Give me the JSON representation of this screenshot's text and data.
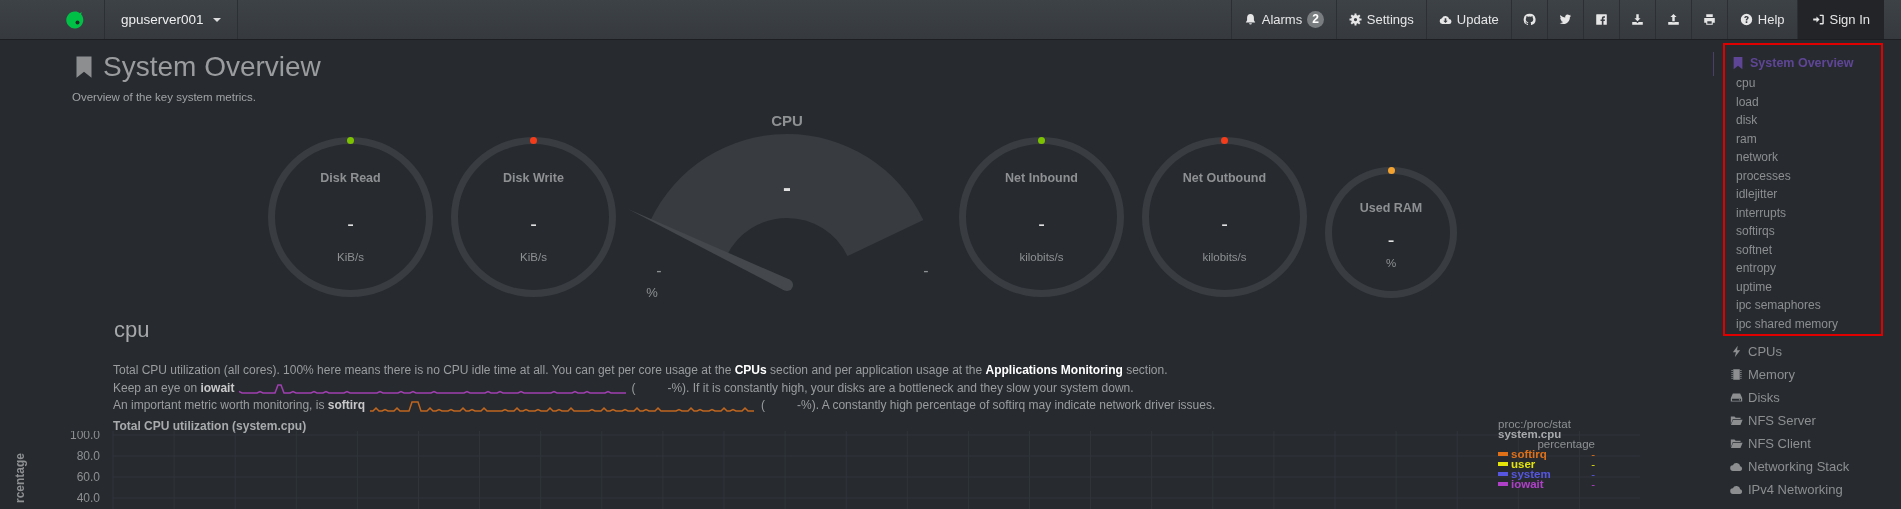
{
  "navbar": {
    "server": "gpuserver001",
    "buttons": [
      {
        "kind": "labeled",
        "label": "Alarms",
        "badge": "2"
      },
      {
        "kind": "labeled",
        "label": "Settings"
      },
      {
        "kind": "labeled",
        "label": "Update"
      },
      {
        "kind": "icon"
      },
      {
        "kind": "icon"
      },
      {
        "kind": "icon"
      },
      {
        "kind": "icon"
      },
      {
        "kind": "icon"
      },
      {
        "kind": "icon"
      },
      {
        "kind": "labeled",
        "label": "Help"
      },
      {
        "kind": "account",
        "label": "Sign In"
      }
    ]
  },
  "header": {
    "title": "System Overview",
    "subtitle": "Overview of the key system metrics."
  },
  "gauges": [
    {
      "kind": "ring",
      "label": "Disk Read",
      "value": "-",
      "unit": "KiB/s",
      "color": "#7cc200"
    },
    {
      "kind": "ring",
      "label": "Disk Write",
      "value": "-",
      "unit": "KiB/s",
      "color": "#f53c1a"
    },
    {
      "kind": "arc",
      "title": "CPU",
      "value": "-",
      "min": "-",
      "max": "-",
      "unit": "%"
    },
    {
      "kind": "ring",
      "label": "Net Inbound",
      "value": "-",
      "unit": "kilobits/s",
      "color": "#7cc200"
    },
    {
      "kind": "ring",
      "label": "Net Outbound",
      "value": "-",
      "unit": "kilobits/s",
      "color": "#f53c1a"
    },
    {
      "kind": "ring-small",
      "label": "Used RAM",
      "value": "-",
      "unit": "%",
      "color": "#f3a12f"
    }
  ],
  "section": {
    "heading": "cpu",
    "intro": "Total CPU utilization (all cores). 100% here means there is no CPU idle time at all. You can get per core usage at the **CPUs** section and per application usage at the **Applications Monitoring** section.",
    "metrics": [
      {
        "lead": "Keep an eye on **iowait**",
        "open": "(",
        "tail": "-%). If it is constantly high, your disks are a bottleneck and they slow your system down.",
        "color": "#a03fb0"
      },
      {
        "lead": "An important metric worth monitoring, is **softirq**",
        "open": "(",
        "tail": "-%). A constantly high percentage of softirq may indicate network driver issues.",
        "color": "#c0661e"
      }
    ],
    "chart": {
      "title": "Total CPU utilization (system.cpu)",
      "y_label": "rcentage",
      "y_ticks": [
        "100.0",
        "80.0",
        "60.0",
        "40.0"
      ]
    },
    "legend": {
      "source": "proc:/proc/stat",
      "chart_id": "system.cpu",
      "units": "percentage",
      "items": [
        {
          "name": "softirq",
          "color": "#e07018",
          "value": "-"
        },
        {
          "name": "user",
          "color": "#e4e40a",
          "value": "-"
        },
        {
          "name": "system",
          "color": "#5656e0",
          "value": "-"
        },
        {
          "name": "iowait",
          "color": "#b040c8",
          "value": "-"
        }
      ]
    }
  },
  "sidebar": {
    "groups": [
      {
        "label": "System Overview",
        "selected": true,
        "highlighted": true,
        "children": [
          {
            "label": "cpu"
          },
          {
            "label": "load"
          },
          {
            "label": "disk"
          },
          {
            "label": "ram"
          },
          {
            "label": "network"
          },
          {
            "label": "processes"
          },
          {
            "label": "idlejitter"
          },
          {
            "label": "interrupts"
          },
          {
            "label": "softirqs"
          },
          {
            "label": "softnet"
          },
          {
            "label": "entropy"
          },
          {
            "label": "uptime"
          },
          {
            "label": "ipc semaphores"
          },
          {
            "label": "ipc shared memory"
          }
        ]
      },
      {
        "label": "CPUs",
        "selected": false,
        "highlighted": false
      },
      {
        "label": "Memory",
        "selected": false,
        "highlighted": false
      },
      {
        "label": "Disks",
        "selected": false,
        "highlighted": false
      },
      {
        "label": "NFS Server",
        "selected": false,
        "highlighted": false
      },
      {
        "label": "NFS Client",
        "selected": false,
        "highlighted": false
      },
      {
        "label": "Networking Stack",
        "selected": false,
        "highlighted": false
      },
      {
        "label": "IPv4 Networking",
        "selected": false,
        "highlighted": false
      }
    ]
  }
}
